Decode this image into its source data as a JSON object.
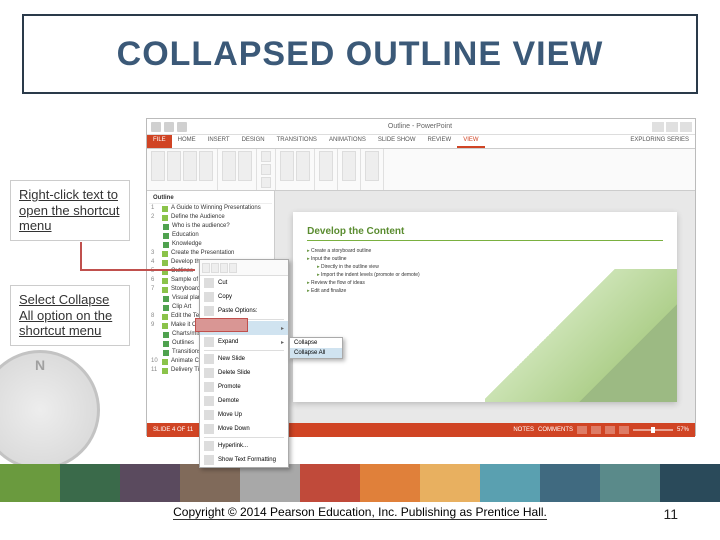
{
  "slide": {
    "title": "COLLAPSED OUTLINE VIEW",
    "copyright": "Copyright © 2014 Pearson Education, Inc. Publishing as Prentice Hall.",
    "page_number": "11"
  },
  "callouts": {
    "c1": "Right-click text to open the shortcut menu",
    "c2": "Select Collapse All option on the shortcut menu"
  },
  "ppt": {
    "doc_title": "Outline - PowerPoint",
    "tabs": {
      "file": "FILE",
      "home": "HOME",
      "insert": "INSERT",
      "design": "DESIGN",
      "transitions": "TRANSITIONS",
      "animations": "ANIMATIONS",
      "slideshow": "SLIDE SHOW",
      "review": "REVIEW",
      "view": "VIEW"
    },
    "explorer_tag": "Exploring Series",
    "outline": {
      "header": "Outline",
      "i1": "A Guide to Winning Presentations",
      "i2": "Define the Audience",
      "i2a": "Who is the audience?",
      "i2b": "Education",
      "i2c": "Knowledge",
      "i3": "Create the Presentation",
      "i4": "Develop the",
      "i5": "Outlines",
      "i6": "Sample of the",
      "i7": "Storyboard",
      "i7a": "Visual plan",
      "i7b": "Clip Art",
      "i8": "Edit the Text",
      "i9": "Make it Clear",
      "i9a": "Charts/mixed",
      "i9b": "Outlines",
      "i9c": "Transitions",
      "i10": "Animate Content",
      "i11": "Delivery Tips"
    },
    "context_menu": {
      "cut": "Cut",
      "copy": "Copy",
      "paste": "Paste Options:",
      "collapse": "Collapse",
      "expand": "Expand",
      "new_slide": "New Slide",
      "delete": "Delete Slide",
      "promote": "Promote",
      "demote": "Demote",
      "move_up": "Move Up",
      "move_down": "Move Down",
      "hyperlink": "Hyperlink...",
      "show_text": "Show Text Formatting"
    },
    "submenu": {
      "collapse": "Collapse",
      "collapse_all": "Collapse All"
    },
    "slide_content": {
      "heading": "Develop the Content",
      "b1": "Create a storyboard outline",
      "b2": "Input the outline",
      "b2a": "Directly in the outline view",
      "b2b": "Import the indent levels (promote or demote)",
      "b3": "Review the flow of ideas",
      "b4": "Edit and finalize"
    },
    "status": {
      "left": "SLIDE 4 OF 11",
      "notes": "NOTES",
      "comments": "COMMENTS",
      "zoom": "57%"
    }
  },
  "color_band": [
    "#6a9a3e",
    "#3a6a4a",
    "#5a4a5e",
    "#806a5a",
    "#a8a8a8",
    "#c04a3a",
    "#e0803a",
    "#e8b060",
    "#5aa0b0",
    "#406a80",
    "#5a8a8a",
    "#2a4a5a"
  ]
}
